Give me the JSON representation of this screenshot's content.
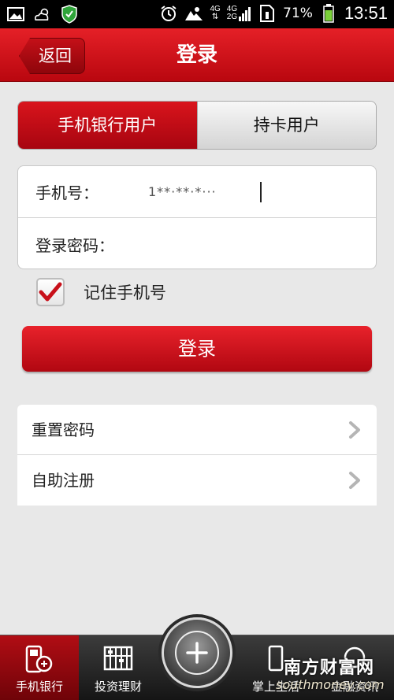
{
  "status_bar": {
    "network": "4G",
    "sim1": "4G",
    "sim2": "2G",
    "battery": "71%",
    "time": "13:51"
  },
  "header": {
    "back_label": "返回",
    "title": "登录"
  },
  "tabs": [
    {
      "label": "手机银行用户",
      "active": true
    },
    {
      "label": "持卡用户",
      "active": false
    }
  ],
  "form": {
    "phone_label": "手机号：",
    "phone_value": "1**·**·*···",
    "password_label": "登录密码："
  },
  "remember": {
    "label": "记住手机号",
    "checked": true
  },
  "login_button": "登录",
  "links": [
    {
      "label": "重置密码"
    },
    {
      "label": "自助注册"
    }
  ],
  "bottom_nav": [
    {
      "label": "手机银行",
      "icon": "phone-bank-icon",
      "active": true
    },
    {
      "label": "投资理财",
      "icon": "abacus-icon",
      "active": false
    },
    {
      "label": "掌上生活",
      "icon": "life-icon",
      "active": false
    },
    {
      "label": "金融资讯",
      "icon": "info-icon",
      "active": false
    }
  ],
  "watermark": {
    "line1": "南方财富网",
    "line2": "southmoney.com"
  },
  "colors": {
    "brand_red": "#d3131b",
    "background": "#e8e8e8"
  }
}
